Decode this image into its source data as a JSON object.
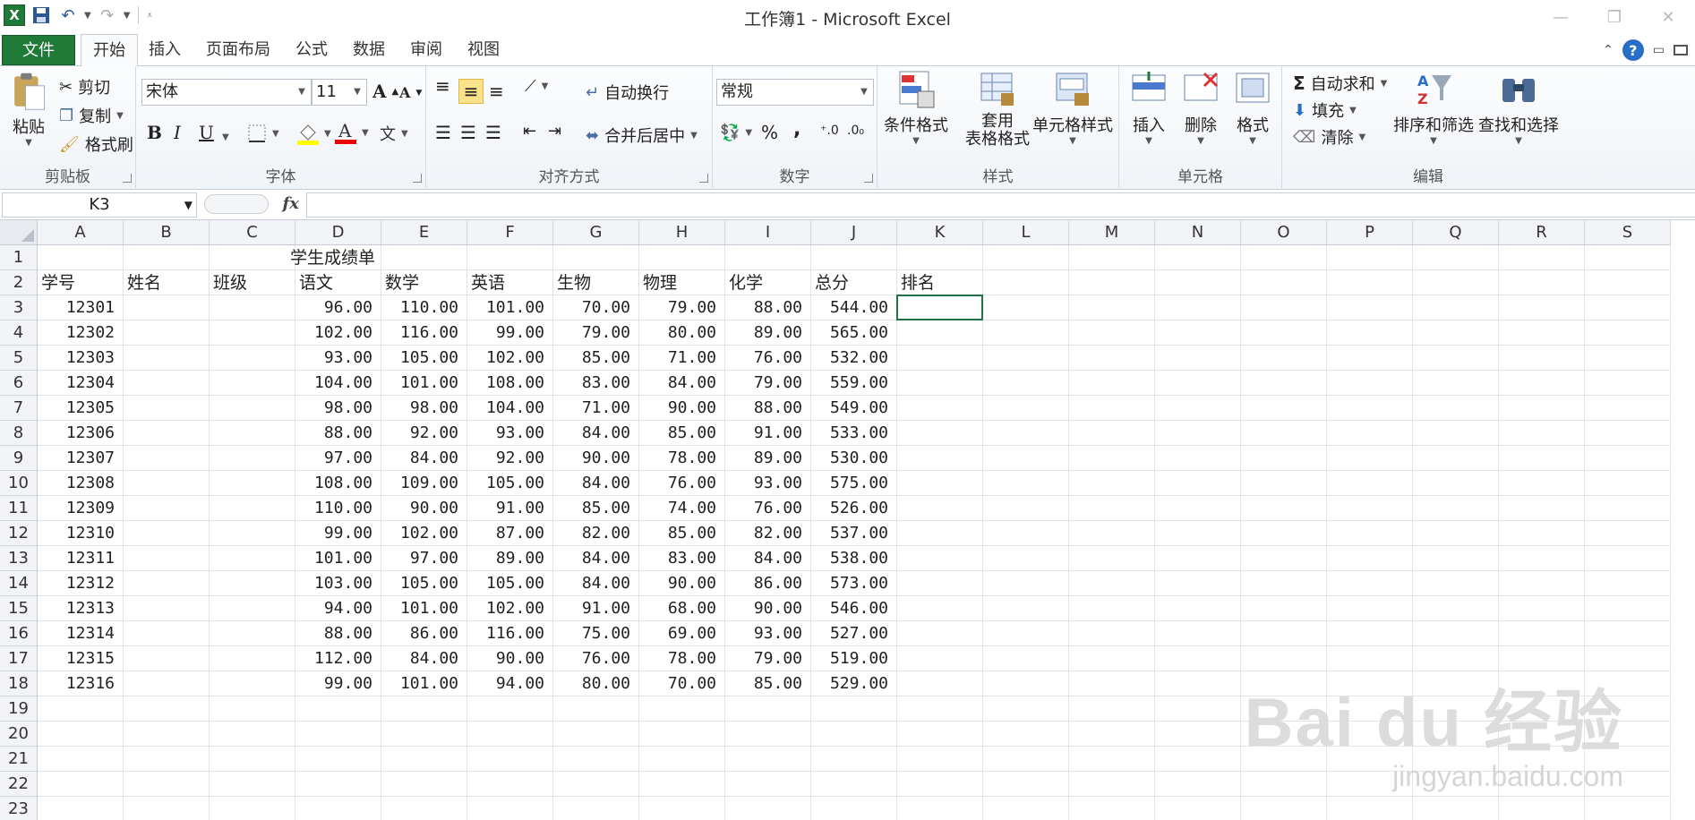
{
  "window": {
    "title": "工作簿1 - Microsoft Excel"
  },
  "tabs": [
    {
      "label": "文件"
    },
    {
      "label": "开始"
    },
    {
      "label": "插入"
    },
    {
      "label": "页面布局"
    },
    {
      "label": "公式"
    },
    {
      "label": "数据"
    },
    {
      "label": "审阅"
    },
    {
      "label": "视图"
    }
  ],
  "ribbon": {
    "clipboard": {
      "label": "剪贴板",
      "paste": "粘贴",
      "cut": "剪切",
      "copy": "复制",
      "format_painter": "格式刷"
    },
    "font": {
      "label": "字体",
      "font_name": "宋体",
      "font_size": "11",
      "bold": "B",
      "italic": "I",
      "underline": "U"
    },
    "alignment": {
      "label": "对齐方式",
      "wrap_text": "自动换行",
      "merge_center": "合并后居中"
    },
    "number": {
      "label": "数字",
      "format": "常规",
      "percent": "%",
      "comma": ","
    },
    "styles": {
      "label": "样式",
      "conditional": "条件格式",
      "table_line1": "套用",
      "table_line2": "表格格式",
      "cell_styles": "单元格样式"
    },
    "cells": {
      "label": "单元格",
      "insert": "插入",
      "delete": "删除",
      "format": "格式"
    },
    "editing": {
      "label": "编辑",
      "autosum": "自动求和",
      "fill": "填充",
      "clear": "清除",
      "sort_filter": "排序和筛选",
      "find_select": "查找和选择"
    }
  },
  "formula_bar": {
    "name_box": "K3",
    "fx": "fx",
    "formula": ""
  },
  "columns": [
    "A",
    "B",
    "C",
    "D",
    "E",
    "F",
    "G",
    "H",
    "I",
    "J",
    "K",
    "L",
    "M",
    "N",
    "O",
    "P",
    "Q",
    "R",
    "S"
  ],
  "rows": [
    "1",
    "2",
    "3",
    "4",
    "5",
    "6",
    "7",
    "8",
    "9",
    "10",
    "11",
    "12",
    "13",
    "14",
    "15",
    "16",
    "17",
    "18",
    "19",
    "20",
    "21",
    "22",
    "23"
  ],
  "sheet": {
    "title": "学生成绩单",
    "headers": [
      "学号",
      "姓名",
      "班级",
      "语文",
      "数学",
      "英语",
      "生物",
      "物理",
      "化学",
      "总分",
      "排名"
    ],
    "records": [
      [
        "12301",
        "",
        "",
        "96.00",
        "110.00",
        "101.00",
        "70.00",
        "79.00",
        "88.00",
        "544.00"
      ],
      [
        "12302",
        "",
        "",
        "102.00",
        "116.00",
        "99.00",
        "79.00",
        "80.00",
        "89.00",
        "565.00"
      ],
      [
        "12303",
        "",
        "",
        "93.00",
        "105.00",
        "102.00",
        "85.00",
        "71.00",
        "76.00",
        "532.00"
      ],
      [
        "12304",
        "",
        "",
        "104.00",
        "101.00",
        "108.00",
        "83.00",
        "84.00",
        "79.00",
        "559.00"
      ],
      [
        "12305",
        "",
        "",
        "98.00",
        "98.00",
        "104.00",
        "71.00",
        "90.00",
        "88.00",
        "549.00"
      ],
      [
        "12306",
        "",
        "",
        "88.00",
        "92.00",
        "93.00",
        "84.00",
        "85.00",
        "91.00",
        "533.00"
      ],
      [
        "12307",
        "",
        "",
        "97.00",
        "84.00",
        "92.00",
        "90.00",
        "78.00",
        "89.00",
        "530.00"
      ],
      [
        "12308",
        "",
        "",
        "108.00",
        "109.00",
        "105.00",
        "84.00",
        "76.00",
        "93.00",
        "575.00"
      ],
      [
        "12309",
        "",
        "",
        "110.00",
        "90.00",
        "91.00",
        "85.00",
        "74.00",
        "76.00",
        "526.00"
      ],
      [
        "12310",
        "",
        "",
        "99.00",
        "102.00",
        "87.00",
        "82.00",
        "85.00",
        "82.00",
        "537.00"
      ],
      [
        "12311",
        "",
        "",
        "101.00",
        "97.00",
        "89.00",
        "84.00",
        "83.00",
        "84.00",
        "538.00"
      ],
      [
        "12312",
        "",
        "",
        "103.00",
        "105.00",
        "105.00",
        "84.00",
        "90.00",
        "86.00",
        "573.00"
      ],
      [
        "12313",
        "",
        "",
        "94.00",
        "101.00",
        "102.00",
        "91.00",
        "68.00",
        "90.00",
        "546.00"
      ],
      [
        "12314",
        "",
        "",
        "88.00",
        "86.00",
        "116.00",
        "75.00",
        "69.00",
        "93.00",
        "527.00"
      ],
      [
        "12315",
        "",
        "",
        "112.00",
        "84.00",
        "90.00",
        "76.00",
        "78.00",
        "79.00",
        "519.00"
      ],
      [
        "12316",
        "",
        "",
        "99.00",
        "101.00",
        "94.00",
        "80.00",
        "70.00",
        "85.00",
        "529.00"
      ]
    ]
  },
  "watermark": {
    "main": "Bai du 经验",
    "sub": "jingyan.baidu.com"
  },
  "colors": {
    "file_tab": "#1e7a36",
    "accent": "#217346",
    "help": "#2a6fc7"
  }
}
